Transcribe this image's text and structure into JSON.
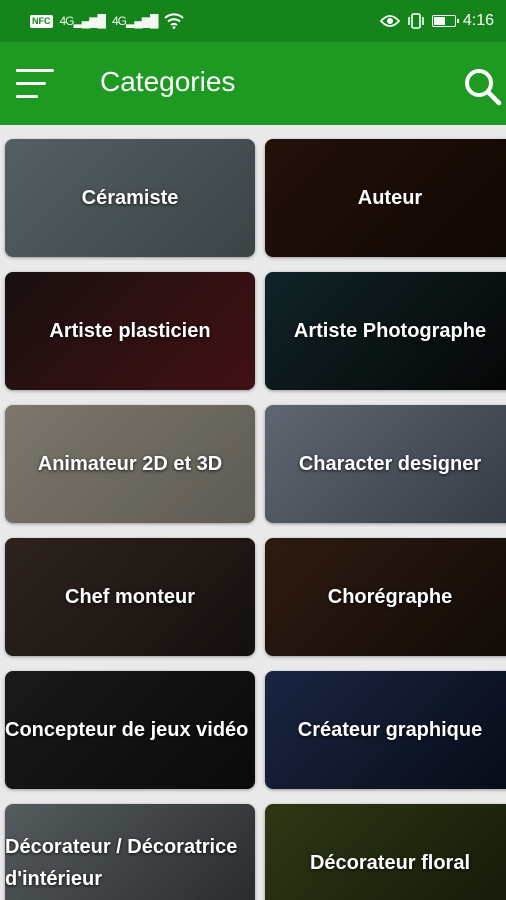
{
  "status_bar": {
    "network_badge": "NFC",
    "signal_1": "4G",
    "signal_2": "4G",
    "battery_level": 0.6,
    "time": "4:16"
  },
  "app_bar": {
    "title": "Categories",
    "menu_icon": "hamburger-menu-icon",
    "search_icon": "search-icon"
  },
  "colors": {
    "status_bar": "#15841a",
    "app_bar": "#1e9a23",
    "background": "#e9e9e9"
  },
  "categories": [
    {
      "label": "Céramiste",
      "bg": "linear-gradient(135deg,#8a9aa0,#5f6f74)"
    },
    {
      "label": "Auteur",
      "bg": "linear-gradient(135deg,#3a1c10,#1a0c06)"
    },
    {
      "label": "Artiste plasticien",
      "bg": "linear-gradient(135deg,#2a1a1a,#6a1a20)"
    },
    {
      "label": "Artiste Photographe",
      "bg": "linear-gradient(135deg,#1a3a40,#0a0a0a)"
    },
    {
      "label": "Animateur 2D et 3D",
      "bg": "linear-gradient(135deg,#c8c0b0,#9a9488)"
    },
    {
      "label": "Character designer",
      "bg": "linear-gradient(135deg,#9aa6b8,#556070)"
    },
    {
      "label": "Chef monteur",
      "bg": "linear-gradient(135deg,#4a3a32,#231a16)"
    },
    {
      "label": "Chorégraphe",
      "bg": "linear-gradient(135deg,#4a2c1c,#1e120c)"
    },
    {
      "label": "Concepteur de jeux vidéo",
      "bg": "linear-gradient(135deg,#2a2a2a,#111)"
    },
    {
      "label": "Créateur graphique",
      "bg": "linear-gradient(135deg,#2a3c6a,#0c1426)"
    },
    {
      "label": "Décorateur / Décoratrice d'intérieur",
      "bg": "linear-gradient(135deg,#8a9498,#3e4448)"
    },
    {
      "label": "Décorateur floral",
      "bg": "linear-gradient(135deg,#4a5a20,#1e2a10)"
    }
  ]
}
